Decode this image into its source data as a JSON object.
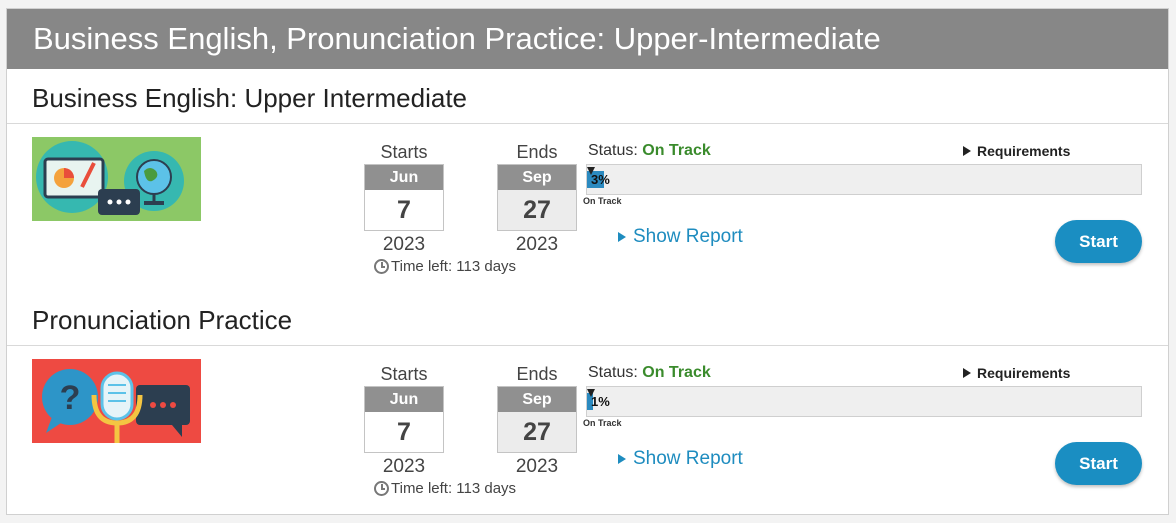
{
  "header": {
    "title": "Business English, Pronunciation Practice: Upper-Intermediate"
  },
  "colors": {
    "header_bg": "#878787",
    "accent": "#1a8ec2",
    "status_ok": "#3a8b2c"
  },
  "courses": [
    {
      "title": "Business English: Upper Intermediate",
      "thumbnail_icon": "presentation-chat-globe-icon",
      "starts": {
        "label": "Starts",
        "month": "Jun",
        "day": "7",
        "year": "2023"
      },
      "ends": {
        "label": "Ends",
        "month": "Sep",
        "day": "27",
        "year": "2023"
      },
      "time_left": "Time left: 113 days",
      "status_label": "Status:",
      "status_value": "On Track",
      "progress_percent": 3,
      "progress_text": "3%",
      "progress_marker_label": "On Track",
      "requirements_label": "Requirements",
      "show_report_label": "Show Report",
      "start_label": "Start"
    },
    {
      "title": "Pronunciation Practice",
      "thumbnail_icon": "microphone-speech-icon",
      "starts": {
        "label": "Starts",
        "month": "Jun",
        "day": "7",
        "year": "2023"
      },
      "ends": {
        "label": "Ends",
        "month": "Sep",
        "day": "27",
        "year": "2023"
      },
      "time_left": "Time left: 113 days",
      "status_label": "Status:",
      "status_value": "On Track",
      "progress_percent": 1,
      "progress_text": "1%",
      "progress_marker_label": "On Track",
      "requirements_label": "Requirements",
      "show_report_label": "Show Report",
      "start_label": "Start"
    }
  ]
}
